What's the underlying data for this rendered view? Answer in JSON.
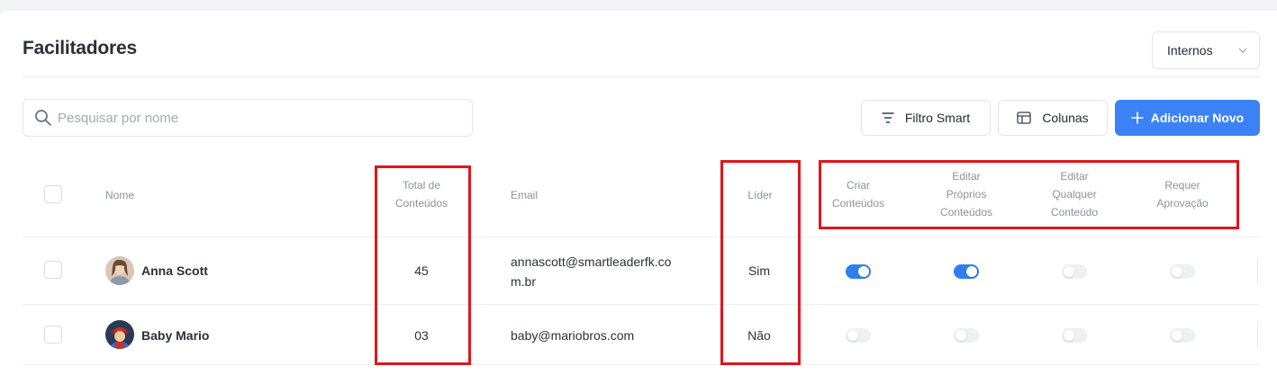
{
  "page": {
    "title": "Facilitadores"
  },
  "filter_select": {
    "value": "Internos"
  },
  "search": {
    "placeholder": "Pesquisar por nome",
    "value": ""
  },
  "toolbar": {
    "filter_label": "Filtro Smart",
    "columns_label": "Colunas",
    "add_label": "Adicionar Novo"
  },
  "table": {
    "headers": {
      "name": "Nome",
      "total_line1": "Total de",
      "total_line2": "Conteúdos",
      "email": "Email",
      "leader": "Líder",
      "create_line1": "Criar",
      "create_line2": "Conteúdos",
      "edit_own_line1": "Editar",
      "edit_own_line2": "Próprios",
      "edit_own_line3": "Conteúdos",
      "edit_any_line1": "Editar",
      "edit_any_line2": "Qualquer",
      "edit_any_line3": "Conteúdo",
      "approval_line1": "Requer",
      "approval_line2": "Aprovação"
    },
    "rows": [
      {
        "name": "Anna Scott",
        "total": "45",
        "email_line1": "annascott@smartleaderfk.co",
        "email_line2": "m.br",
        "leader": "Sim",
        "create": true,
        "edit_own": true,
        "edit_any": false,
        "approval": false
      },
      {
        "name": "Baby Mario",
        "total": "03",
        "email_line1": "baby@mariobros.com",
        "email_line2": "",
        "leader": "Não",
        "create": false,
        "edit_own": false,
        "edit_any": false,
        "approval": false
      }
    ]
  },
  "colors": {
    "accent": "#3b82f6",
    "toggle_on": "#2f80ed",
    "highlight": "#e0151c"
  }
}
